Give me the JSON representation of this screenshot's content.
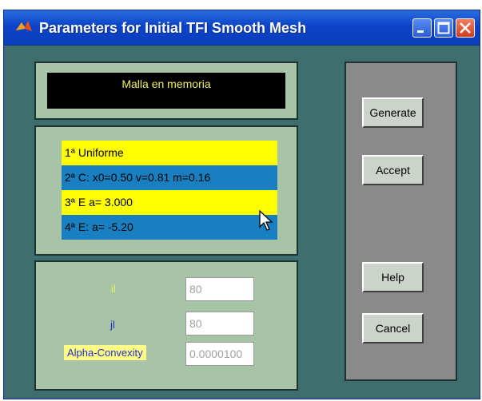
{
  "window": {
    "title": "Parameters for Initial TFI Smooth Mesh"
  },
  "display": {
    "message": "Malla en memoria"
  },
  "mesh_list": {
    "items": [
      "1ª Uniforme",
      "2ª  C: x0=0.50 v=0.81 m=0.16",
      "3ª  E a= 3.000",
      "4ª  E: a= -5.20"
    ]
  },
  "params": {
    "il_label": "il",
    "jl_label": "jl",
    "alpha_label": "Alpha-Convexity",
    "il_value": "80",
    "jl_value": "80",
    "alpha_value": "0.0000100"
  },
  "buttons": {
    "generate": "Generate",
    "accept": "Accept",
    "help": "Help",
    "cancel": "Cancel"
  },
  "colors": {
    "window_bg": "#3e6e6e",
    "panel_bg": "#a7c4a7",
    "highlight_yellow": "#ffff00",
    "highlight_blue": "#1880c0",
    "display_text": "#f0f060"
  },
  "icons": {
    "app": "matlab-logo-icon",
    "minimize": "minimize-icon",
    "maximize": "maximize-icon",
    "close": "close-icon",
    "cursor": "mouse-pointer-icon"
  }
}
